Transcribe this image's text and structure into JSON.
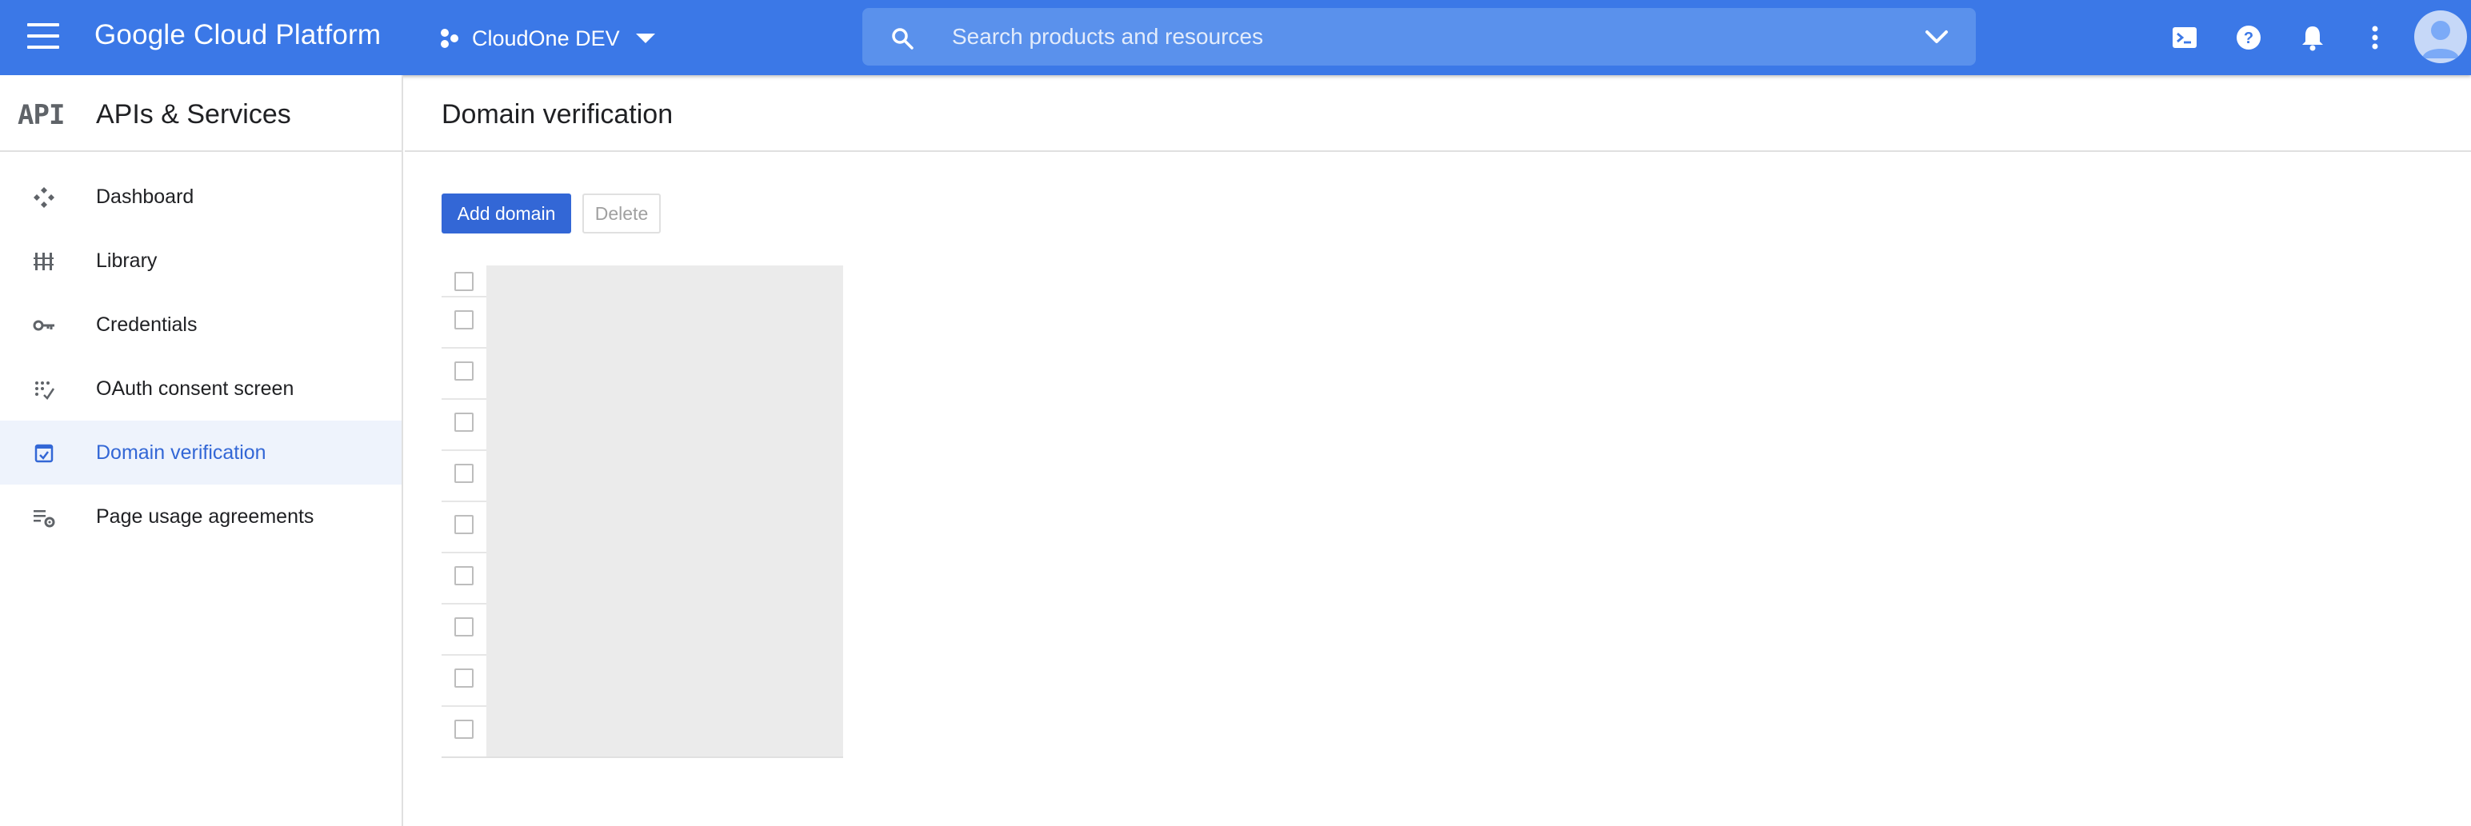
{
  "topbar": {
    "brand": "Google Cloud Platform",
    "project_name": "CloudOne DEV",
    "search_placeholder": "Search products and resources",
    "icons": [
      "menu-icon",
      "project-icon",
      "search-icon",
      "chevron-down-icon",
      "cloud-shell-icon",
      "help-icon",
      "notifications-icon",
      "more-vert-icon",
      "account-avatar"
    ],
    "color": "#3b78e7"
  },
  "sidebar": {
    "logo_text": "API",
    "title": "APIs & Services",
    "items": [
      {
        "label": "Dashboard",
        "icon": "dashboard-icon",
        "active": false
      },
      {
        "label": "Library",
        "icon": "library-icon",
        "active": false
      },
      {
        "label": "Credentials",
        "icon": "key-icon",
        "active": false
      },
      {
        "label": "OAuth consent screen",
        "icon": "oauth-consent-icon",
        "active": false
      },
      {
        "label": "Domain verification",
        "icon": "domain-verification-icon",
        "active": true
      },
      {
        "label": "Page usage agreements",
        "icon": "page-usage-settings-icon",
        "active": false
      }
    ],
    "active_color": "#3367d6"
  },
  "main": {
    "title": "Domain verification",
    "add_button": "Add domain",
    "delete_button": "Delete",
    "table": {
      "header_checkbox": false,
      "row_checkboxes": [
        false,
        false,
        false,
        false,
        false,
        false,
        false,
        false,
        false
      ]
    }
  }
}
